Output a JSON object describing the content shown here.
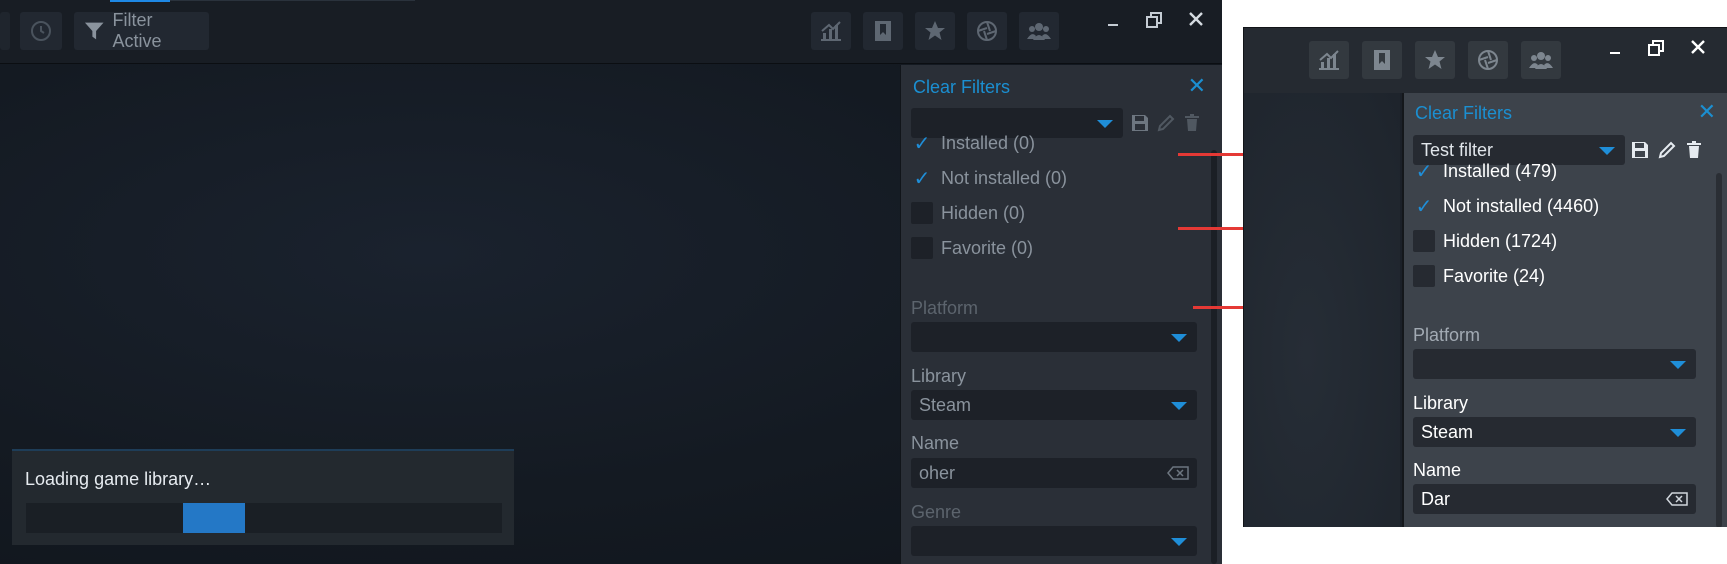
{
  "left": {
    "toolbar": {
      "filter_label": "Filter Active"
    },
    "filter_panel": {
      "clear_label": "Clear Filters",
      "preset_value": "",
      "checkboxes": [
        {
          "label": "Installed (0)",
          "checked": true
        },
        {
          "label": "Not installed (0)",
          "checked": true
        },
        {
          "label": "Hidden (0)",
          "checked": false
        },
        {
          "label": "Favorite (0)",
          "checked": false
        }
      ],
      "platform_label": "Platform",
      "platform_value": "",
      "library_label": "Library",
      "library_value": "Steam",
      "name_label": "Name",
      "name_value": "oher",
      "genre_label": "Genre",
      "genre_value": ""
    },
    "loading": {
      "text": "Loading game library…",
      "progress_start": 0.33,
      "progress_end": 0.46
    }
  },
  "right": {
    "filter_panel": {
      "clear_label": "Clear Filters",
      "preset_value": "Test filter",
      "checkboxes": [
        {
          "label": "Installed (479)",
          "checked": true
        },
        {
          "label": "Not installed (4460)",
          "checked": true
        },
        {
          "label": "Hidden (1724)",
          "checked": false
        },
        {
          "label": "Favorite (24)",
          "checked": false
        }
      ],
      "platform_label": "Platform",
      "platform_value": "",
      "library_label": "Library",
      "library_value": "Steam",
      "name_label": "Name",
      "name_value": "Dar"
    }
  },
  "colors": {
    "accent": "#1f8ed8",
    "arrow": "#e53935",
    "progress": "#2478c6"
  },
  "icons": [
    "filter-icon",
    "stats-icon",
    "bookmark-icon",
    "star-icon",
    "aperture-icon",
    "friends-icon",
    "minimize-icon",
    "restore-icon",
    "close-icon",
    "save-icon",
    "edit-icon",
    "trash-icon",
    "clear-text-icon"
  ]
}
